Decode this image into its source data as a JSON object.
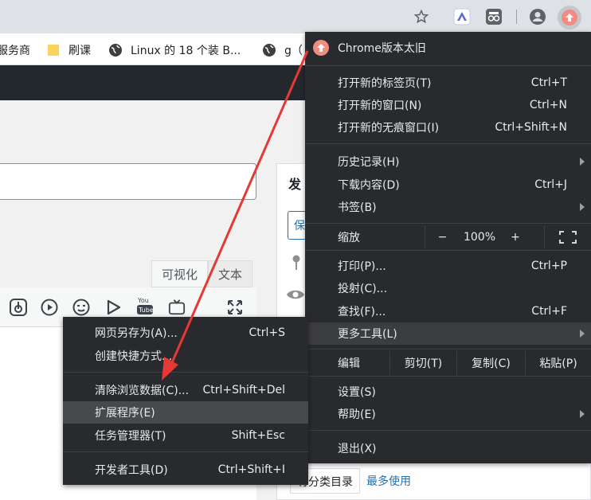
{
  "colors": {
    "menu_bg": "#292a2d",
    "menu_text": "#e8eaed",
    "highlight": "#3c3d40",
    "arrow": "#e53935",
    "update_badge": "#f28b82",
    "wp_admin_bar": "#23282d",
    "link_blue": "#2271b1"
  },
  "toolbar": {
    "icons": [
      "star-icon",
      "extension-bird-icon",
      "extension-glasses-icon",
      "profile-icon",
      "update-badge-icon"
    ]
  },
  "bookmarks": {
    "items": [
      {
        "label": "服务商",
        "icon": "none"
      },
      {
        "label": "刷课",
        "icon": "folder-icon"
      },
      {
        "label": "Linux 的 18 个装 B...",
        "icon": "globe-icon"
      },
      {
        "label": "g（",
        "icon": "globe-icon"
      }
    ]
  },
  "editor": {
    "tabs": {
      "visual": "可视化",
      "text": "文本"
    }
  },
  "side_panel": {
    "title": "发",
    "button_label": "保",
    "category_tab": "有分类目录",
    "most_used": "最多使用"
  },
  "chrome_menu": {
    "update": "Chrome版本太旧",
    "new_tab": {
      "label": "打开新的标签页(T)",
      "shortcut": "Ctrl+T"
    },
    "new_window": {
      "label": "打开新的窗口(N)",
      "shortcut": "Ctrl+N"
    },
    "new_incognito": {
      "label": "打开新的无痕窗口(I)",
      "shortcut": "Ctrl+Shift+N"
    },
    "history": {
      "label": "历史记录(H)"
    },
    "downloads": {
      "label": "下载内容(D)",
      "shortcut": "Ctrl+J"
    },
    "bookmarks": {
      "label": "书签(B)"
    },
    "zoom": {
      "label": "缩放",
      "minus": "−",
      "value": "100%",
      "plus": "+"
    },
    "print": {
      "label": "打印(P)...",
      "shortcut": "Ctrl+P"
    },
    "cast": {
      "label": "投射(C)..."
    },
    "find": {
      "label": "查找(F)...",
      "shortcut": "Ctrl+F"
    },
    "more_tools": {
      "label": "更多工具(L)"
    },
    "edit": {
      "label": "编辑",
      "cut": "剪切(T)",
      "copy": "复制(C)",
      "paste": "粘贴(P)"
    },
    "settings": {
      "label": "设置(S)"
    },
    "help": {
      "label": "帮助(E)"
    },
    "exit": {
      "label": "退出(X)"
    }
  },
  "sub_menu": {
    "save_page": {
      "label": "网页另存为(A)...",
      "shortcut": "Ctrl+S"
    },
    "create_shortcut": {
      "label": "创建快捷方式..."
    },
    "clear_data": {
      "label": "清除浏览数据(C)...",
      "shortcut": "Ctrl+Shift+Del"
    },
    "extensions": {
      "label": "扩展程序(E)"
    },
    "task_manager": {
      "label": "任务管理器(T)",
      "shortcut": "Shift+Esc"
    },
    "dev_tools": {
      "label": "开发者工具(D)",
      "shortcut": "Ctrl+Shift+I"
    }
  }
}
